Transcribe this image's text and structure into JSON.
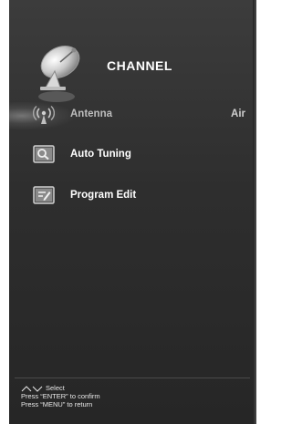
{
  "header": {
    "title": "CHANNEL",
    "icon": "satellite-dish-icon"
  },
  "menu": {
    "items": [
      {
        "label": "Antenna",
        "value": "Air",
        "icon": "antenna-icon",
        "selected": true
      },
      {
        "label": "Auto Tuning",
        "value": "",
        "icon": "magnifier-icon",
        "selected": false
      },
      {
        "label": "Program Edit",
        "value": "",
        "icon": "edit-icon",
        "selected": false
      }
    ]
  },
  "footer": {
    "select_label": "Select",
    "enter_hint": "Press “ENTER” to confirm",
    "menu_hint": "Press “MENU” to return"
  },
  "colors": {
    "background": "#2e2e2e",
    "text": "#ffffff",
    "dim_text": "#bdbdbd"
  }
}
